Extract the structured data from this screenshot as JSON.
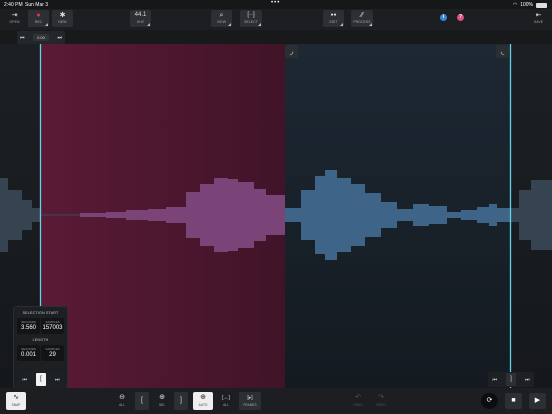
{
  "status": {
    "time": "2:40 PM",
    "date": "Sun Mar 3",
    "dots": "•••",
    "battery": "100%"
  },
  "toolbar": {
    "open": {
      "icon": "⇥",
      "label": "OPEN"
    },
    "rec": {
      "icon": "●",
      "label": "REC"
    },
    "new": {
      "icon": "✱",
      "label": "NEW"
    },
    "rate": {
      "icon": "44.1",
      "label": "KHZ"
    },
    "view": {
      "icon": "⌕",
      "label": "VIEW"
    },
    "select": {
      "icon": "[··]",
      "label": "SELECT"
    },
    "edit": {
      "icon": "●●",
      "label": "EDIT"
    },
    "process": {
      "icon": "⁄⁄",
      "label": "PROCESS"
    },
    "info": "i",
    "help": "?",
    "save": {
      "icon": "⇤",
      "label": "SAVE"
    }
  },
  "snap": {
    "prev": "⏮",
    "value": "0.00",
    "next": "⏭"
  },
  "fade_in": "◞",
  "fade_out": "◟",
  "selection": {
    "start_title": "SELECTION START",
    "start_seconds_label": "SECONDS",
    "start_seconds": "3.560",
    "start_samples_label": "SAMPLES",
    "start_samples": "157003",
    "length_title": "LENGTH",
    "length_seconds_label": "SECONDS",
    "length_seconds": "0.001",
    "length_samples_label": "SAMPLES",
    "length_samples": "29"
  },
  "nudge_left": {
    "prev": "⏮",
    "mid": "[",
    "next": "⏭"
  },
  "nudge_right": {
    "prev": "⏮",
    "mid": "]",
    "next": "⏭"
  },
  "bottom": {
    "snap": {
      "icon": "∿",
      "label": "SNAP"
    },
    "zoom_all": {
      "icon": "⊖",
      "label": "ALL"
    },
    "bracket_l": {
      "icon": "[",
      "label": ""
    },
    "zoom_sel": {
      "icon": "⊕",
      "label": "SEL"
    },
    "bracket_r": {
      "icon": "]",
      "label": ""
    },
    "zoom_auto": {
      "icon": "⊕",
      "label": "AUTO"
    },
    "sel_all": {
      "icon": "[↔]",
      "label": "ALL"
    },
    "sel_frames": {
      "icon": "[▸]",
      "label": "FRAMES"
    },
    "undo": {
      "icon": "↶",
      "label": "UNDO"
    },
    "redo": {
      "icon": "↷",
      "label": "REDO"
    },
    "loop": "⟳",
    "stop": "■",
    "play": "▶"
  },
  "colors": {
    "selection": "#6a1f3e",
    "accent": "#5fd4e8",
    "wave_sel": "#8a4a8a",
    "wave": "#4f7aa3"
  }
}
